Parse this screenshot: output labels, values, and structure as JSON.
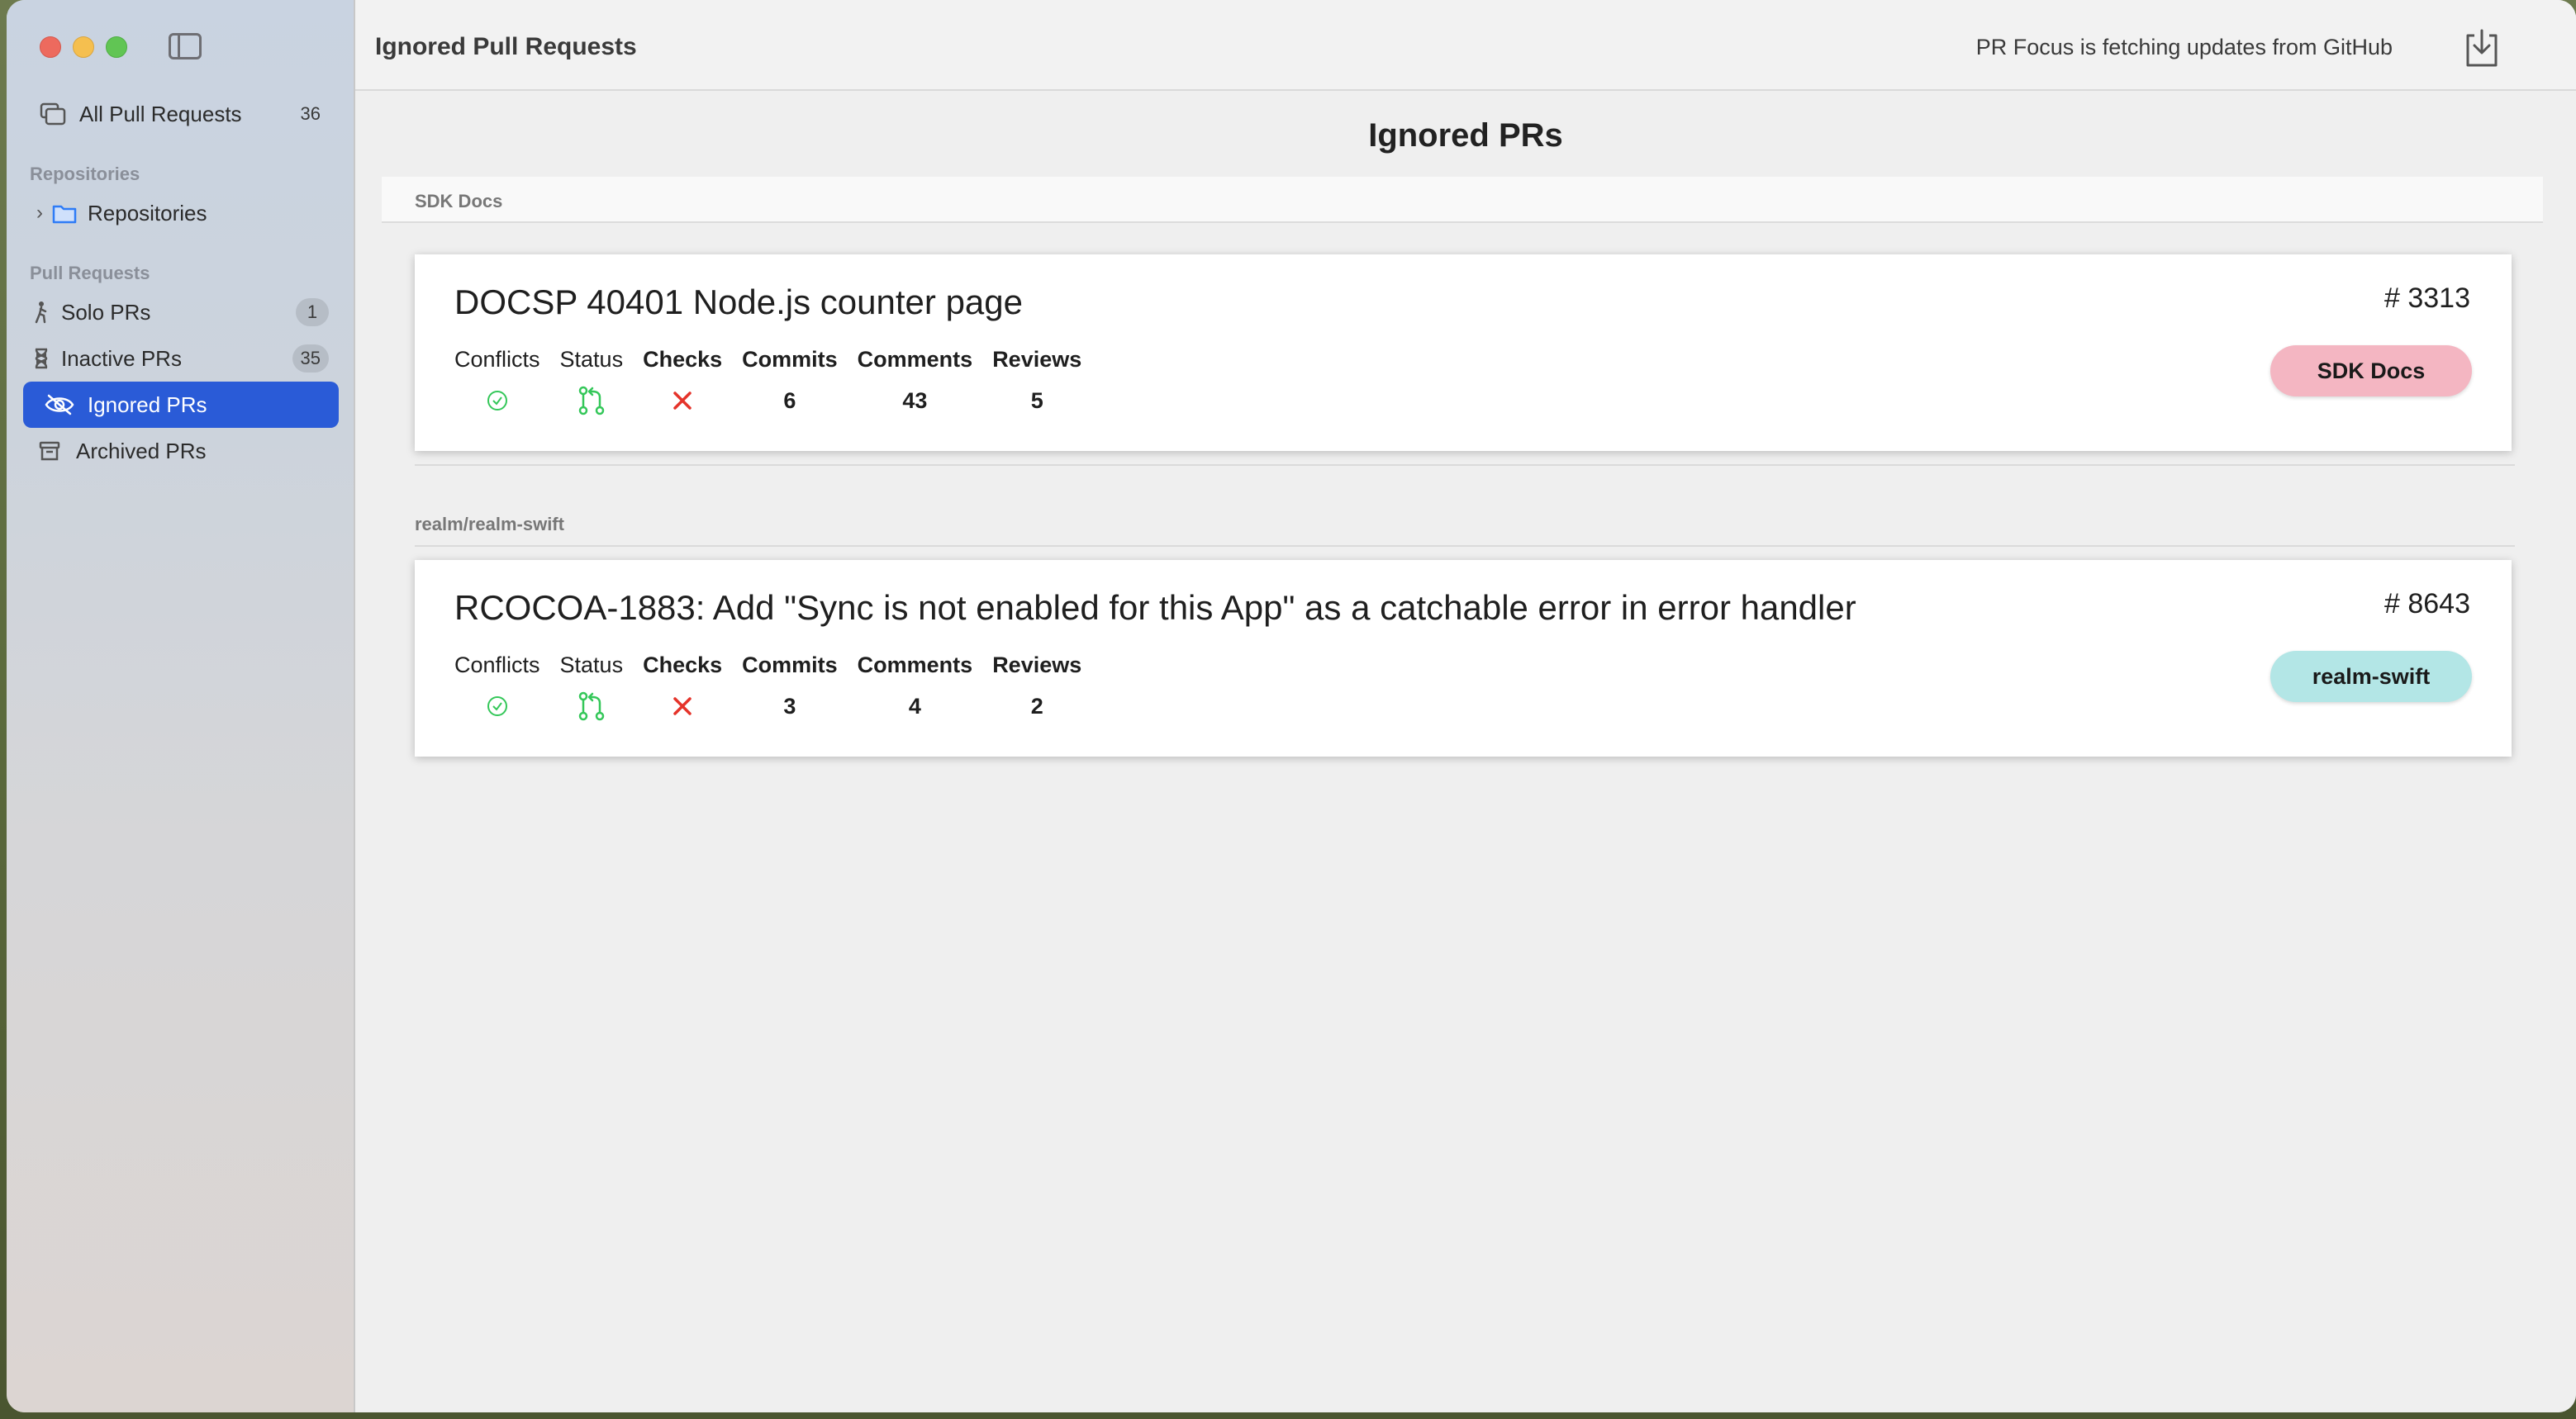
{
  "window": {
    "toolbar_title": "Ignored Pull Requests",
    "status": "PR Focus is fetching updates from GitHub"
  },
  "sidebar": {
    "all": {
      "label": "All Pull Requests",
      "count": "36"
    },
    "repositories_header": "Repositories",
    "repositories_item": "Repositories",
    "pull_requests_header": "Pull Requests",
    "items": [
      {
        "label": "Solo PRs",
        "count": "1"
      },
      {
        "label": "Inactive PRs",
        "count": "35"
      },
      {
        "label": "Ignored PRs",
        "count": ""
      },
      {
        "label": "Archived PRs",
        "count": ""
      }
    ]
  },
  "main": {
    "page_title": "Ignored PRs",
    "stat_headers": {
      "conflicts": "Conflicts",
      "status": "Status",
      "checks": "Checks",
      "commits": "Commits",
      "comments": "Comments",
      "reviews": "Reviews"
    },
    "groups": [
      {
        "name": "SDK Docs",
        "pr": {
          "title": "DOCSP 40401 Node.js counter page",
          "number": "# 3313",
          "commits": "6",
          "comments": "43",
          "reviews": "5",
          "badge": "SDK Docs",
          "badge_color": "#f4b6c2"
        }
      },
      {
        "name": "realm/realm-swift",
        "pr": {
          "title": "RCOCOA-1883: Add \"Sync is not enabled for this App\" as a catchable error in error handler",
          "number": "# 8643",
          "commits": "3",
          "comments": "4",
          "reviews": "2",
          "badge": "realm-swift",
          "badge_color": "#b3e6e6"
        }
      }
    ]
  },
  "colors": {
    "accent": "#2a5bd7",
    "success": "#34c759",
    "error": "#e5332a"
  }
}
